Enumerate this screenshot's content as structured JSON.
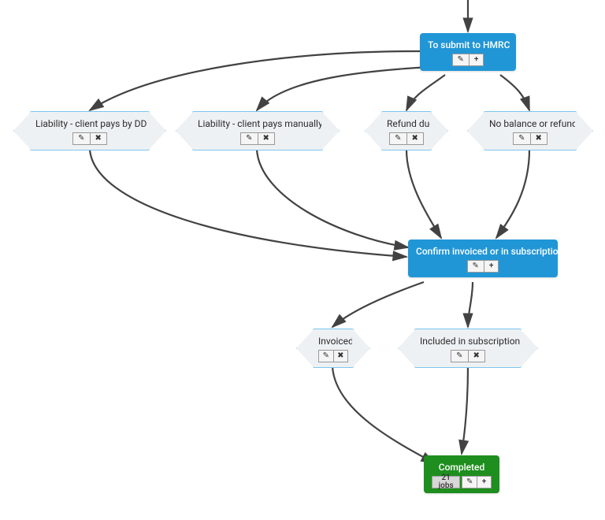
{
  "nodes": {
    "submit_hmrc": {
      "label": "To submit to HMRC"
    },
    "liability_dd": {
      "label": "Liability - client pays by DD"
    },
    "liability_manual": {
      "label": "Liability - client pays manually"
    },
    "refund_due": {
      "label": "Refund due"
    },
    "no_balance": {
      "label": "No balance or refund"
    },
    "confirm_invoiced": {
      "label": "Confirm invoiced or in subscription"
    },
    "invoiced": {
      "label": "Invoiced"
    },
    "included_sub": {
      "label": "Included in subscription"
    },
    "completed": {
      "label": "Completed",
      "jobs_badge": "21 jobs"
    }
  },
  "icons": {
    "edit": "✎",
    "add": "+",
    "delete": "✖"
  },
  "colors": {
    "blue": "#2196d6",
    "green": "#1e8e1e",
    "hex_fill": "#eef1f3",
    "hex_border": "#7cc6ef",
    "arrow": "#424242"
  }
}
